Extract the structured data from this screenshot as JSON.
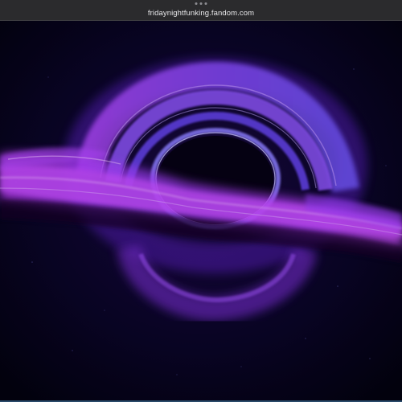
{
  "browser": {
    "url": "fridaynightfunking.fandom.com"
  },
  "colors": {
    "background": "#05021a",
    "accent_purple": "#9b3dff",
    "accent_blue": "#6a5cff",
    "chrome_bar": "#2b2b2d",
    "url_text": "#e8e8ea"
  },
  "icons": {
    "handle": "tab-handle-icon"
  }
}
